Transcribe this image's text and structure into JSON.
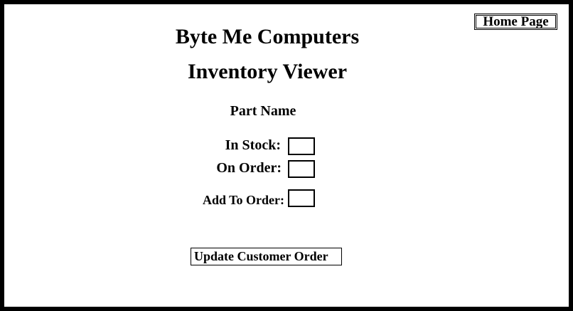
{
  "header": {
    "home_button_label": "Home Page",
    "company_title": "Byte Me Computers",
    "page_title": "Inventory Viewer"
  },
  "part": {
    "name_label": "Part Name"
  },
  "fields": {
    "in_stock_label": "In Stock:",
    "in_stock_value": "",
    "on_order_label": "On Order:",
    "on_order_value": "",
    "add_to_order_label": "Add To Order:",
    "add_to_order_value": ""
  },
  "actions": {
    "update_button_label": "Update Customer Order"
  },
  "colors": {
    "border": "#000000",
    "background": "#ffffff",
    "text": "#000000"
  }
}
